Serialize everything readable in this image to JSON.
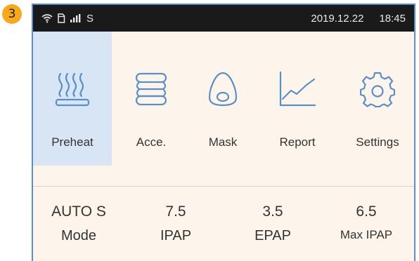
{
  "step_badge": "3",
  "status_bar": {
    "carrier": "S",
    "date": "2019.12.22",
    "time": "18:45",
    "icons": [
      "wifi-icon",
      "sim-card-icon",
      "signal-icon"
    ]
  },
  "menu": {
    "items": [
      {
        "label": "Preheat",
        "icon": "heater-icon",
        "active": true
      },
      {
        "label": "Acce.",
        "icon": "accessory-icon",
        "active": false
      },
      {
        "label": "Mask",
        "icon": "mask-icon",
        "active": false
      },
      {
        "label": "Report",
        "icon": "report-chart-icon",
        "active": false
      },
      {
        "label": "Settings",
        "icon": "gear-icon",
        "active": false
      }
    ]
  },
  "params": [
    {
      "value": "AUTO S",
      "label": "Mode"
    },
    {
      "value": "7.5",
      "label": "IPAP"
    },
    {
      "value": "3.5",
      "label": "EPAP"
    },
    {
      "value": "6.5",
      "label": "Max IPAP"
    }
  ],
  "colors": {
    "accent": "#5b8fc7",
    "active_bg": "#d7e5f4",
    "screen_bg": "#fdf5ec",
    "badge": "#f6a81e"
  }
}
